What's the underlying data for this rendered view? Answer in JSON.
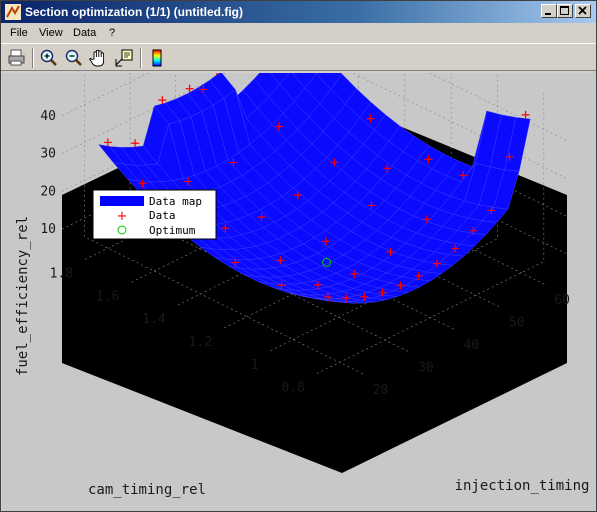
{
  "window": {
    "title": "Section optimization (1/1) (untitled.fig)"
  },
  "menu": {
    "items": [
      "File",
      "View",
      "Data",
      "?"
    ]
  },
  "toolbar": {
    "tools": [
      "print-icon",
      "zoom-in-icon",
      "zoom-out-icon",
      "pan-hand-icon",
      "data-cursor-icon",
      "colorbar-icon"
    ]
  },
  "chart_data": {
    "type": "surface3d",
    "xlabel": "injection_timing",
    "ylabel": "cam_timing_rel",
    "zlabel": "fuel_efficiency_rel",
    "xticks": [
      "20",
      "30",
      "40",
      "50",
      "60"
    ],
    "yticks": [
      "0.8",
      "1",
      "1.2",
      "1.4",
      "1.6",
      "1.8"
    ],
    "zticks": [
      "10",
      "20",
      "30",
      "40"
    ],
    "legend": [
      "Data map",
      "Data",
      "Optimum"
    ],
    "legend_placement": "top-left",
    "grid": true,
    "colors": {
      "surface": "#0000ff",
      "data_marker": "#ff0000",
      "optimum_marker": "#00cc00",
      "axes_background": "#000000"
    },
    "optimum": {
      "injection_timing": 35,
      "cam_timing_rel": 1.15,
      "fuel_efficiency_rel": 12
    }
  }
}
